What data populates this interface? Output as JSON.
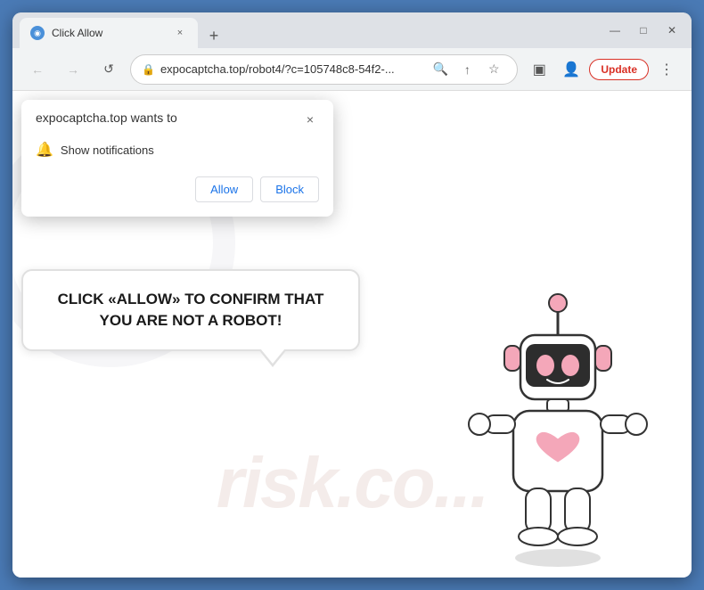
{
  "browser": {
    "tab": {
      "favicon_symbol": "◉",
      "title": "Click Allow",
      "close_label": "×",
      "new_tab_label": "+"
    },
    "window_controls": {
      "minimize": "—",
      "maximize": "□",
      "close": "✕"
    },
    "nav": {
      "back": "←",
      "forward": "→",
      "reload": "↺"
    },
    "address_bar": {
      "lock_icon": "🔒",
      "url": "expocaptcha.top/robot4/?c=105748c8-54f2-..."
    },
    "toolbar_actions": {
      "search": "🔍",
      "share": "↑",
      "bookmark": "☆",
      "split": "▣",
      "profile": "👤",
      "update_label": "Update",
      "more": "⋮"
    }
  },
  "notification_popup": {
    "site_text": "expocaptcha.top wants to",
    "close_label": "×",
    "permission_icon": "🔔",
    "permission_text": "Show notifications",
    "allow_label": "Allow",
    "block_label": "Block"
  },
  "page": {
    "captcha_message": "CLICK «ALLOW» TO CONFIRM THAT YOU ARE NOT A ROBOT!",
    "watermark_text": "risk.co..."
  }
}
